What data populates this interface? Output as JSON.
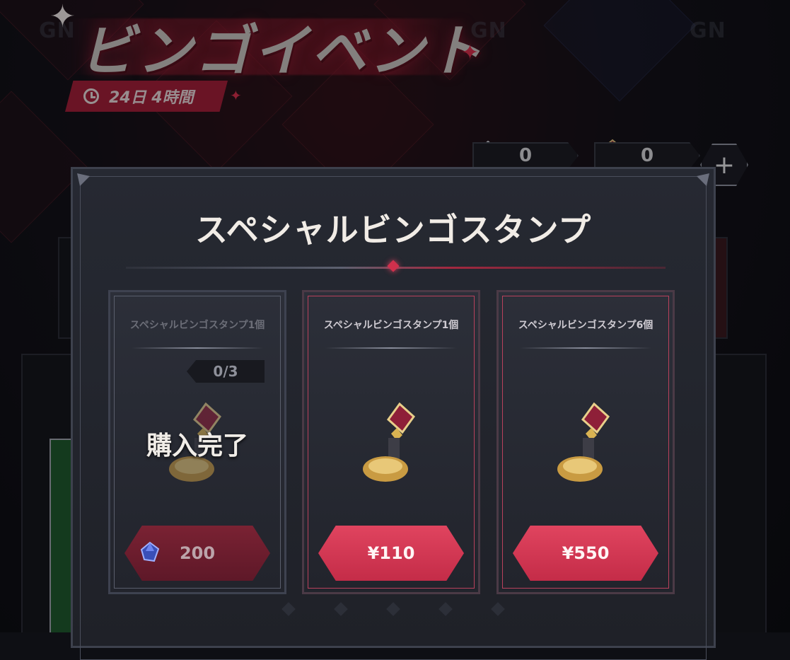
{
  "header": {
    "event_title": "ビンゴイベント",
    "timer_text": "24日 4時間"
  },
  "background": {
    "logo_text": "GN"
  },
  "currency": {
    "item1_count": "0",
    "item2_count": "0",
    "add_button": "+"
  },
  "modal": {
    "title": "スペシャルビンゴスタンプ",
    "cards": [
      {
        "name": "スペシャルビンゴスタンプ1個",
        "limit": "0/3",
        "status": "購入完了",
        "price": "200",
        "price_currency_icon": "gem-icon",
        "state": "purchased"
      },
      {
        "name": "スペシャルビンゴスタンプ1個",
        "price": "¥110",
        "state": "available"
      },
      {
        "name": "スペシャルビンゴスタンプ6個",
        "price": "¥550",
        "state": "available"
      }
    ]
  },
  "colors": {
    "accent_red": "#d0304c",
    "button_red": "#e0445f",
    "panel": "#262932"
  }
}
